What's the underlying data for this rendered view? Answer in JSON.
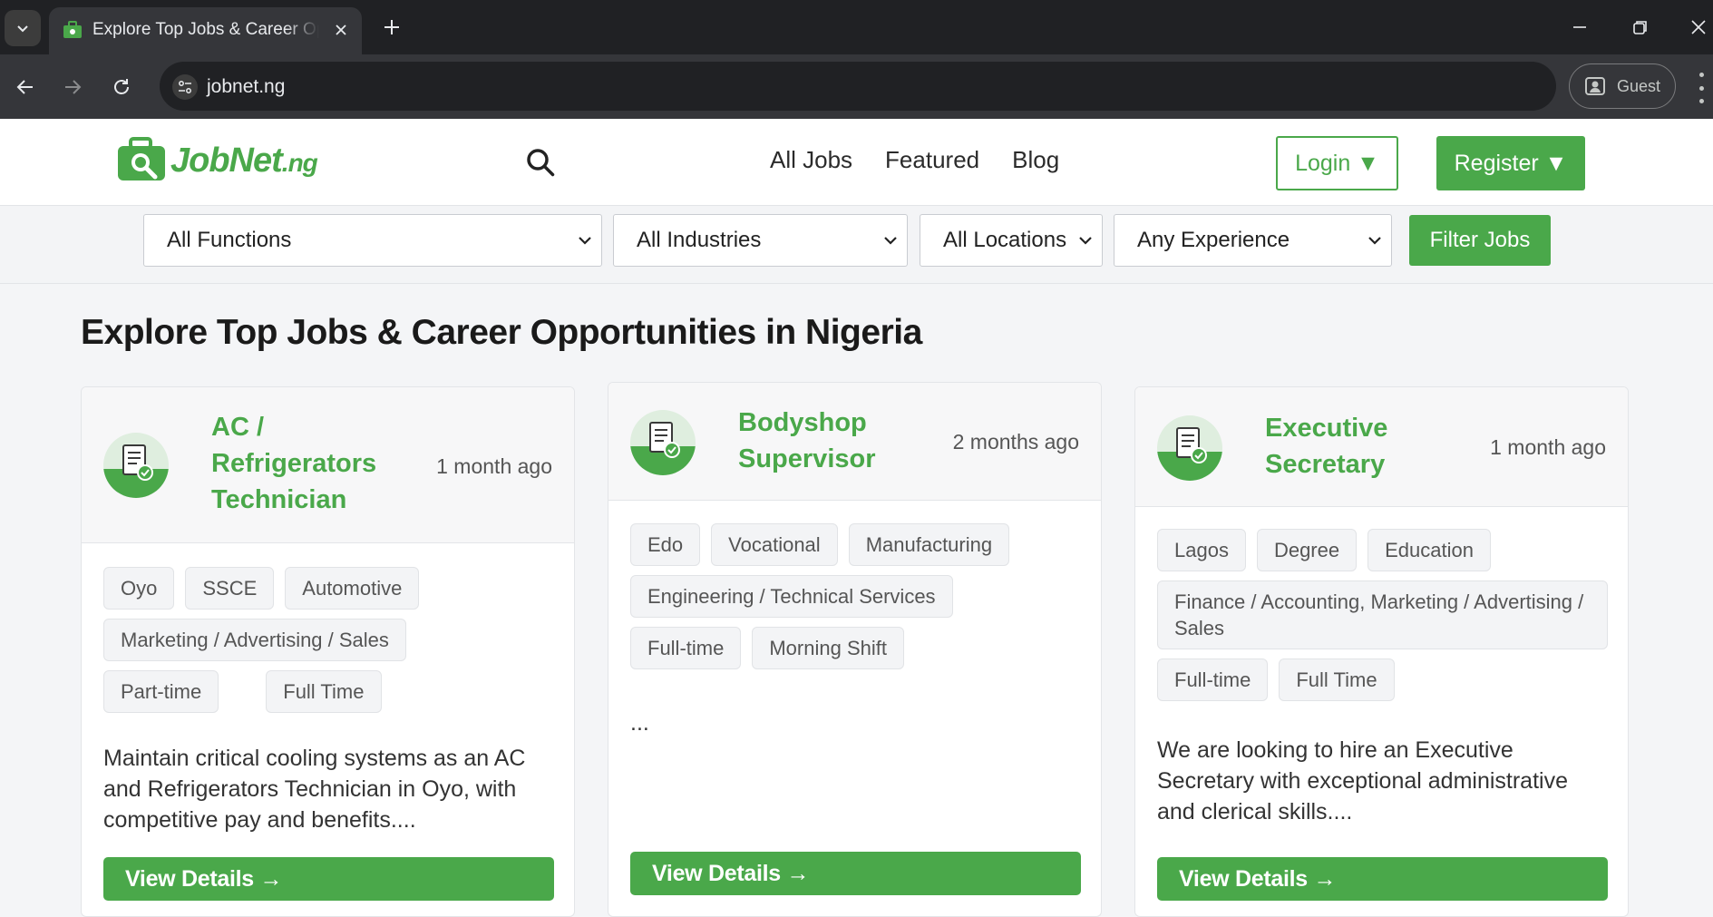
{
  "browser": {
    "tab_title": "Explore Top Jobs & Career Opportunities in Nigeria",
    "url": "jobnet.ng",
    "profile_label": "Guest"
  },
  "site": {
    "brand": "JobNet",
    "brand_tld": ".ng",
    "nav": [
      "All Jobs",
      "Featured",
      "Blog"
    ],
    "login_label": "Login ▼",
    "register_label": "Register ▼",
    "accent_color": "#4aa84a"
  },
  "filters": {
    "functions": "All Functions",
    "industries": "All Industries",
    "locations": "All Locations",
    "experience": "Any Experience",
    "submit_label": "Filter Jobs"
  },
  "page": {
    "title": "Explore Top Jobs & Career Opportunities in Nigeria"
  },
  "jobs": [
    {
      "title": "AC / Refrigerators Technician",
      "posted": "1 month ago",
      "tags": [
        "Oyo",
        "SSCE",
        "Automotive",
        "Marketing / Advertising / Sales",
        "Part-time",
        "Full Time"
      ],
      "description": "Maintain critical cooling systems as an AC and Refrigerators Technician in Oyo, with competitive pay and benefits....",
      "cta": "View Details →"
    },
    {
      "title": "Bodyshop Supervisor",
      "posted": "2 months ago",
      "tags": [
        "Edo",
        "Vocational",
        "Manufacturing",
        "Engineering / Technical Services",
        "Full-time",
        "Morning Shift"
      ],
      "description": "...",
      "cta": "View Details →"
    },
    {
      "title": "Executive Secretary",
      "posted": "1 month ago",
      "tags": [
        "Lagos",
        "Degree",
        "Education",
        "Finance / Accounting, Marketing / Advertising / Sales",
        "Full-time",
        "Full Time"
      ],
      "description": "We are looking to hire an Executive Secretary with exceptional administrative and clerical skills....",
      "cta": "View Details →"
    }
  ]
}
